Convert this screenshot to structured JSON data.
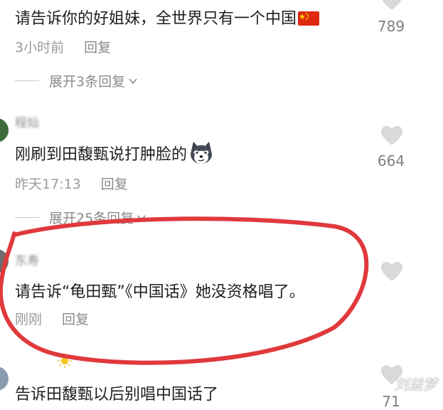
{
  "comments": [
    {
      "text": "请告诉你的好姐妹，全世界只有一个中国",
      "time": "3小时前",
      "reply_label": "回复",
      "likes": "789",
      "expand_label": "展开3条回复"
    },
    {
      "username": "程灿",
      "text": "刚刷到田馥甄说打肿脸的",
      "time": "昨天17:13",
      "reply_label": "回复",
      "likes": "664",
      "expand_label": "展开25条回复"
    },
    {
      "username": "东寿",
      "text": "请告诉“龟田甄”《中国话》她没资格唱了。",
      "time": "刚刚",
      "reply_label": "回复",
      "likes": ""
    },
    {
      "text": "告诉田馥甄以后别唱中国话了",
      "likes": "71"
    }
  ],
  "watermark": "刘益梦",
  "icons": {
    "like": "heart-icon",
    "expand": "chevron-down-icon",
    "flag": "china-flag-icon",
    "emoji": "husky-dog-face-icon"
  },
  "colors": {
    "highlight_ring": "#e0393c",
    "text": "#1f1f1f",
    "muted": "#9a9a9a",
    "heart": "#d9d9d9"
  }
}
